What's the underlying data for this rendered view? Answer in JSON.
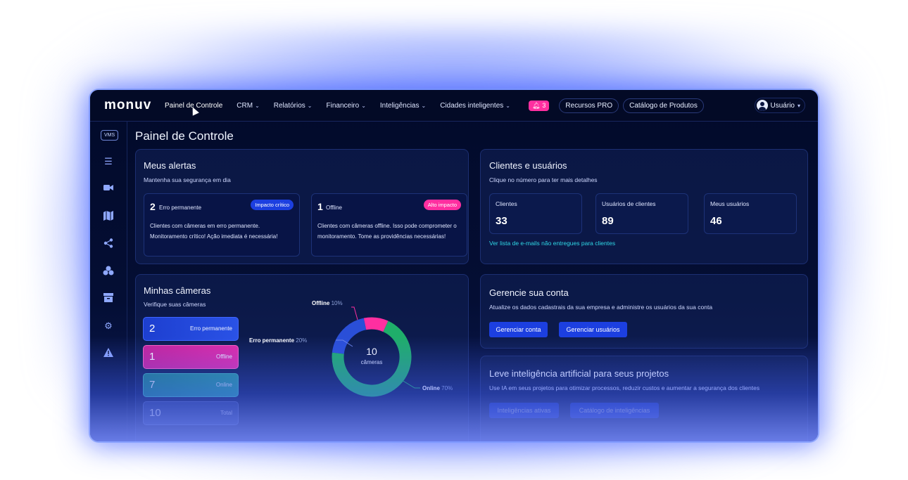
{
  "brand": "monuv",
  "nav": {
    "items": [
      {
        "label": "Painel de Controle"
      },
      {
        "label": "CRM"
      },
      {
        "label": "Relatórios"
      },
      {
        "label": "Financeiro"
      },
      {
        "label": "Inteligências"
      },
      {
        "label": "Cidades inteligentes"
      }
    ],
    "notifications_count": "3",
    "pro_label": "Recursos PRO",
    "catalog_label": "Catálogo de Produtos",
    "user_label": "Usuário"
  },
  "sidebar": {
    "vms_label": "VMS",
    "icons": [
      "list-icon",
      "camera-icon",
      "map-icon",
      "share-icon",
      "boxes-icon",
      "archive-icon",
      "settings-icon",
      "warning-icon"
    ]
  },
  "page_title": "Painel de Controle",
  "alerts": {
    "title": "Meus alertas",
    "subtitle": "Mantenha sua segurança em dia",
    "items": [
      {
        "count": "2",
        "label": "Erro permanente",
        "tag": "Impacto crítico",
        "text": "Clientes com câmeras em erro permanente. Monitoramento crítico! Ação imediata é necessária!"
      },
      {
        "count": "1",
        "label": "Offline",
        "tag": "Alto impacto",
        "text": "Clientes com câmeras offline. Isso pode comprometer o monitoramento. Tome as providências necessárias!"
      }
    ]
  },
  "clients": {
    "title": "Clientes e usuários",
    "subtitle": "Clique no número para ter mais detalhes",
    "stats": [
      {
        "label": "Clientes",
        "value": "33"
      },
      {
        "label": "Usuários de clientes",
        "value": "89"
      },
      {
        "label": "Meus usuários",
        "value": "46"
      }
    ],
    "link": "Ver lista de e-mails não entregues para clientes"
  },
  "cameras": {
    "title": "Minhas câmeras",
    "subtitle": "Verifique suas câmeras",
    "rows": [
      {
        "value": "2",
        "label": "Erro permanente"
      },
      {
        "value": "1",
        "label": "Offline"
      },
      {
        "value": "7",
        "label": "Online"
      },
      {
        "value": "10",
        "label": "Total"
      }
    ],
    "donut": {
      "total": "10",
      "unit": "câmeras",
      "segments": [
        {
          "label": "Offline",
          "pct": "10%",
          "fraction": 0.1,
          "color": "#ff2fa0"
        },
        {
          "label": "Erro permanente",
          "pct": "20%",
          "fraction": 0.2,
          "color": "#2a4fd8"
        },
        {
          "label": "Online",
          "pct": "70%",
          "fraction": 0.7,
          "color": "#1fae6a"
        }
      ]
    }
  },
  "account": {
    "title": "Gerencie sua conta",
    "subtitle": "Atualize os dados cadastrais da sua empresa e administre os usuários da sua conta",
    "btn_account": "Gerenciar conta",
    "btn_users": "Gerenciar usuários"
  },
  "ai": {
    "title": "Leve inteligência artificial para seus projetos",
    "subtitle": "Use IA em seus projetos para otimizar processos, reduzir custos e aumentar a segurança dos clientes",
    "btn_active": "Inteligências ativas",
    "btn_catalog": "Catálogo de inteligências"
  },
  "colors": {
    "accent": "#1c3fe0",
    "pink": "#ff2fa0",
    "online": "#1fae6a",
    "link": "#2fd8e6"
  }
}
